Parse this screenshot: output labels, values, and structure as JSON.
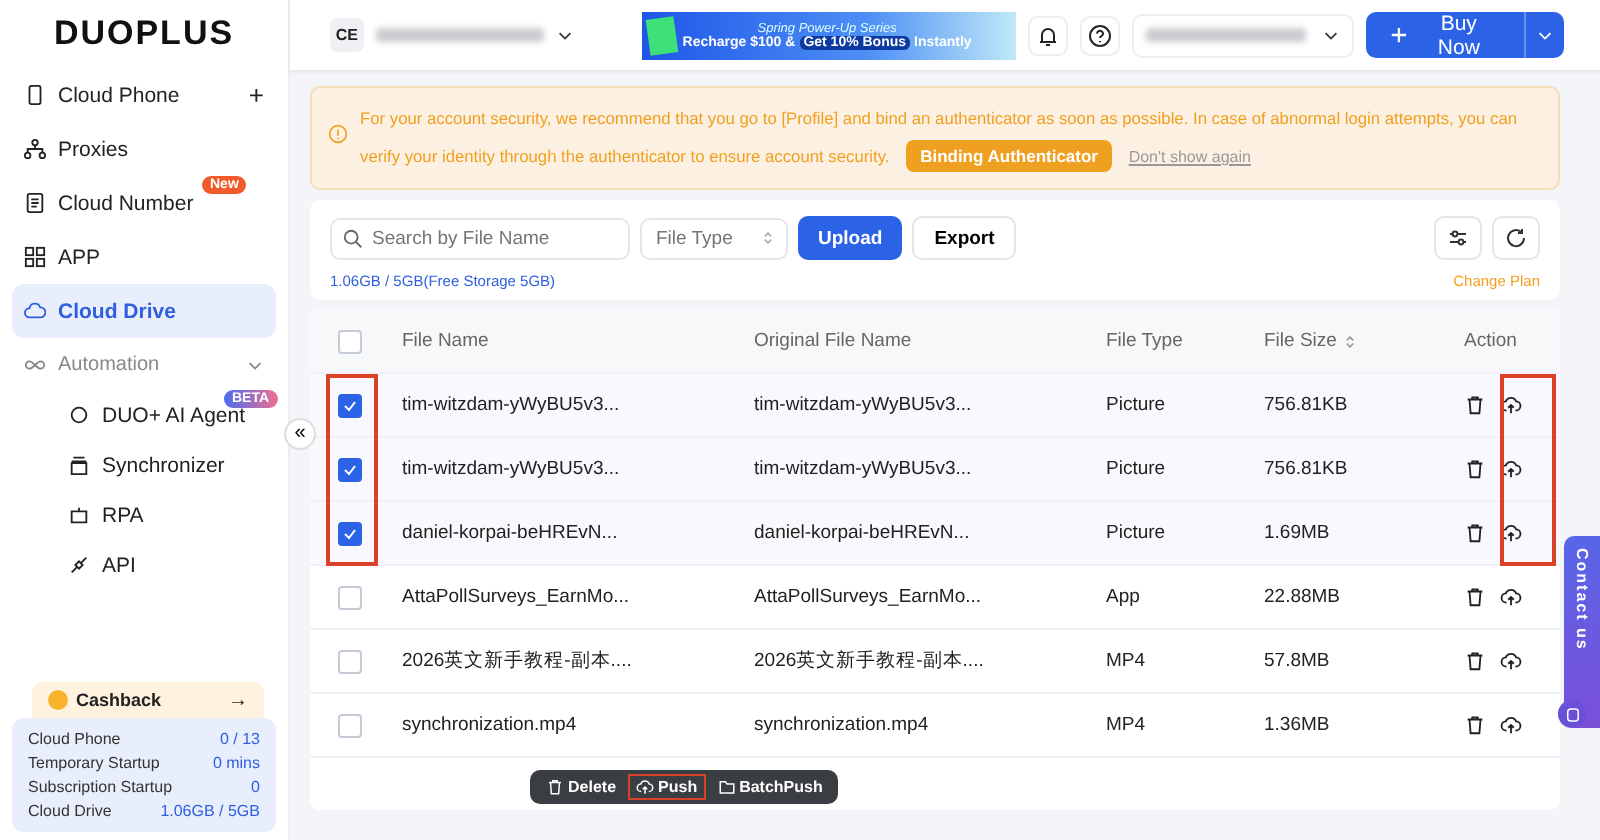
{
  "sidebar": {
    "logo": "DUOPLUS",
    "items": [
      {
        "label": "Cloud Phone",
        "selected": false,
        "action": "+"
      },
      {
        "label": "Proxies",
        "selected": false
      },
      {
        "label": "Cloud Number",
        "selected": false,
        "badge": "New"
      },
      {
        "label": "APP",
        "selected": false
      },
      {
        "label": "Cloud Drive",
        "selected": true
      }
    ],
    "group": {
      "label": "Automation",
      "expanded": true,
      "children": [
        {
          "label": "DUO+ AI Agent",
          "badge": "BETA"
        },
        {
          "label": "Synchronizer"
        },
        {
          "label": "RPA"
        },
        {
          "label": "API"
        }
      ]
    },
    "cashback": {
      "label": "Cashback",
      "arrow": "→"
    },
    "stats": [
      {
        "label": "Cloud Phone",
        "value": "0 / 13"
      },
      {
        "label": "Temporary Startup",
        "value": "0 mins"
      },
      {
        "label": "Subscription Startup",
        "value": "0"
      },
      {
        "label": "Cloud Drive",
        "value": "1.06GB / 5GB"
      }
    ],
    "collapse": "«"
  },
  "header": {
    "avatar": "CE",
    "banner": {
      "title": "Spring Power-Up Series",
      "recharge": "Recharge $100 &",
      "bonus": "Get 10% Bonus",
      "tail": "Instantly"
    },
    "buy_button": "Buy Now"
  },
  "alert": {
    "text": "For your account security, we recommend that you go to [Profile] and bind an authenticator as soon as possible. In case of abnormal login attempts, you can verify your identity through the authenticator to ensure account security.",
    "button": "Binding Authenticator",
    "link": "Don't show again"
  },
  "toolbar": {
    "search_placeholder": "Search by File Name",
    "file_type_placeholder": "File Type",
    "upload": "Upload",
    "export": "Export",
    "storage": "1.06GB / 5GB(Free Storage 5GB)",
    "change_plan": "Change Plan"
  },
  "table": {
    "select_all": false,
    "columns": [
      "File Name",
      "Original File Name",
      "File Type",
      "File Size",
      "Action"
    ],
    "rows": [
      {
        "file_name": "tim-witzdam-yWyBU5v3...",
        "original_name": "tim-witzdam-yWyBU5v3...",
        "type": "Picture",
        "size": "756.81KB",
        "selected": true,
        "highlighted": true
      },
      {
        "file_name": "tim-witzdam-yWyBU5v3...",
        "original_name": "tim-witzdam-yWyBU5v3...",
        "type": "Picture",
        "size": "756.81KB",
        "selected": true,
        "highlighted": true
      },
      {
        "file_name": "daniel-korpai-beHREvN...",
        "original_name": "daniel-korpai-beHREvN...",
        "type": "Picture",
        "size": "1.69MB",
        "selected": true,
        "highlighted": true
      },
      {
        "file_name": "AttaPollSurveys_EarnMo...",
        "original_name": "AttaPollSurveys_EarnMo...",
        "type": "App",
        "size": "22.88MB",
        "selected": false,
        "highlighted": false
      },
      {
        "file_name": "2026英文新手教程-副本....",
        "original_name": "2026英文新手教程-副本....",
        "type": "MP4",
        "size": "57.8MB",
        "selected": false,
        "highlighted": false
      },
      {
        "file_name": "synchronization.mp4",
        "original_name": "synchronization.mp4",
        "type": "MP4",
        "size": "1.36MB",
        "selected": false,
        "highlighted": false
      }
    ]
  },
  "bulk_actions": [
    {
      "label": "Delete",
      "highlighted": false
    },
    {
      "label": "Push",
      "highlighted": true
    },
    {
      "label": "BatchPush",
      "highlighted": false
    }
  ],
  "contact_tab": "Contact us"
}
